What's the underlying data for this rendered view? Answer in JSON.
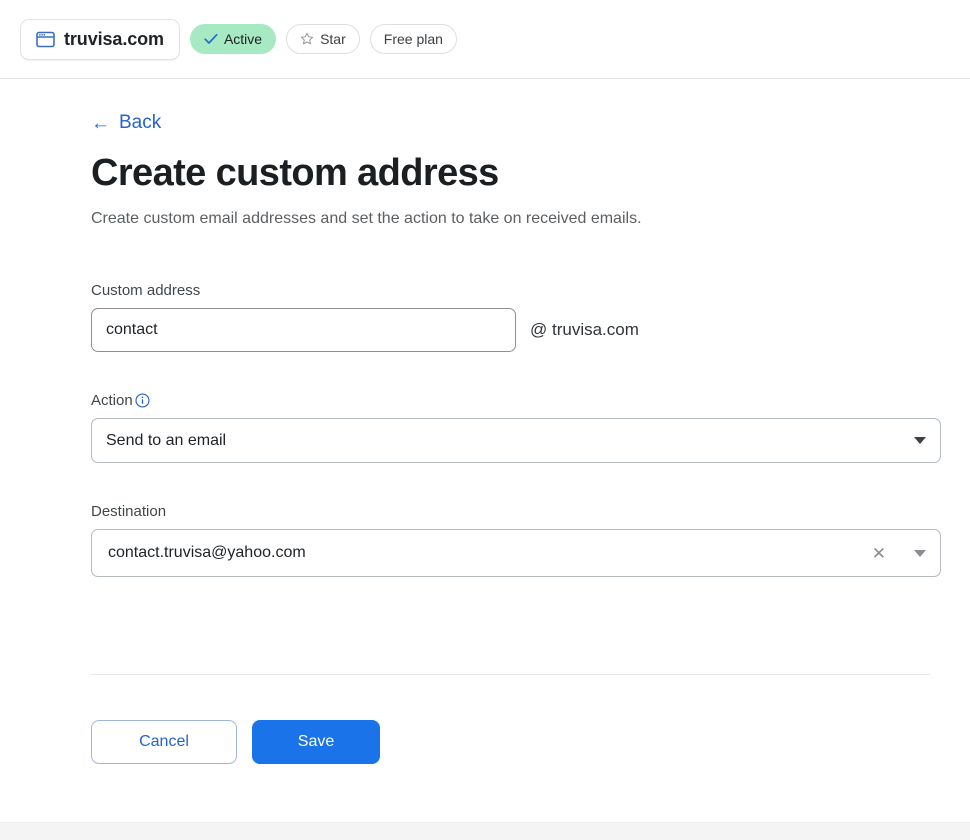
{
  "topbar": {
    "domain_chip": {
      "icon": "browser-window-icon",
      "label": "truvisa.com"
    },
    "pills": [
      {
        "id": "status",
        "icon": "check-icon",
        "label": "Active",
        "style": "green",
        "color": "#a6e9c2"
      },
      {
        "id": "star",
        "icon": "star-outline-icon",
        "label": "Star",
        "style": "outline"
      },
      {
        "id": "plan",
        "icon": null,
        "label": "Free plan",
        "style": "outline"
      }
    ]
  },
  "content": {
    "back_link": {
      "icon": "arrow-left-icon",
      "label": "Back"
    },
    "title": "Create custom address",
    "subtitle": "Create custom email addresses and set the action to take on received emails.",
    "fields": {
      "custom_address": {
        "label": "Custom address",
        "value": "contact",
        "placeholder": "",
        "suffix": "@  truvisa.com"
      },
      "action": {
        "label": "Action",
        "info_icon": "info-circle-icon",
        "value": "Send to an email",
        "caret_icon": "chevron-down-icon"
      },
      "destination": {
        "label": "Destination",
        "value": "contact.truvisa@yahoo.com",
        "placeholder": "",
        "clear_icon": "close-x-icon",
        "caret_icon": "chevron-down-icon"
      }
    },
    "buttons": {
      "cancel": "Cancel",
      "save": "Save"
    }
  },
  "colors": {
    "accent": "#1a73e8",
    "link": "#2463d1",
    "success_bg": "#a6e9c2"
  }
}
